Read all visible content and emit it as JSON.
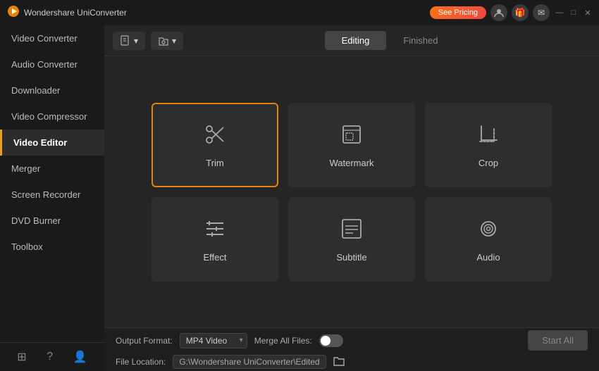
{
  "app": {
    "title": "Wondershare UniConverter",
    "logo_char": "🎬"
  },
  "title_bar": {
    "pricing_label": "See Pricing",
    "min_label": "—",
    "max_label": "□",
    "close_label": "✕"
  },
  "sidebar": {
    "items": [
      {
        "id": "video-converter",
        "label": "Video Converter",
        "active": false
      },
      {
        "id": "audio-converter",
        "label": "Audio Converter",
        "active": false
      },
      {
        "id": "downloader",
        "label": "Downloader",
        "active": false
      },
      {
        "id": "video-compressor",
        "label": "Video Compressor",
        "active": false
      },
      {
        "id": "video-editor",
        "label": "Video Editor",
        "active": true
      },
      {
        "id": "merger",
        "label": "Merger",
        "active": false
      },
      {
        "id": "screen-recorder",
        "label": "Screen Recorder",
        "active": false
      },
      {
        "id": "dvd-burner",
        "label": "DVD Burner",
        "active": false
      },
      {
        "id": "toolbox",
        "label": "Toolbox",
        "active": false
      }
    ]
  },
  "tabs": {
    "editing": "Editing",
    "finished": "Finished",
    "active": "editing"
  },
  "editor_cards": [
    {
      "id": "trim",
      "label": "Trim",
      "icon": "scissors",
      "selected": true
    },
    {
      "id": "watermark",
      "label": "Watermark",
      "icon": "watermark",
      "selected": false
    },
    {
      "id": "crop",
      "label": "Crop",
      "icon": "crop",
      "selected": false
    },
    {
      "id": "effect",
      "label": "Effect",
      "icon": "effect",
      "selected": false
    },
    {
      "id": "subtitle",
      "label": "Subtitle",
      "icon": "subtitle",
      "selected": false
    },
    {
      "id": "audio",
      "label": "Audio",
      "icon": "audio",
      "selected": false
    }
  ],
  "bottom_bar": {
    "output_format_label": "Output Format:",
    "output_format_value": "MP4 Video",
    "merge_label": "Merge All Files:",
    "file_location_label": "File Location:",
    "file_path": "G:\\Wondershare UniConverter\\Edited",
    "start_all_label": "Start All"
  }
}
